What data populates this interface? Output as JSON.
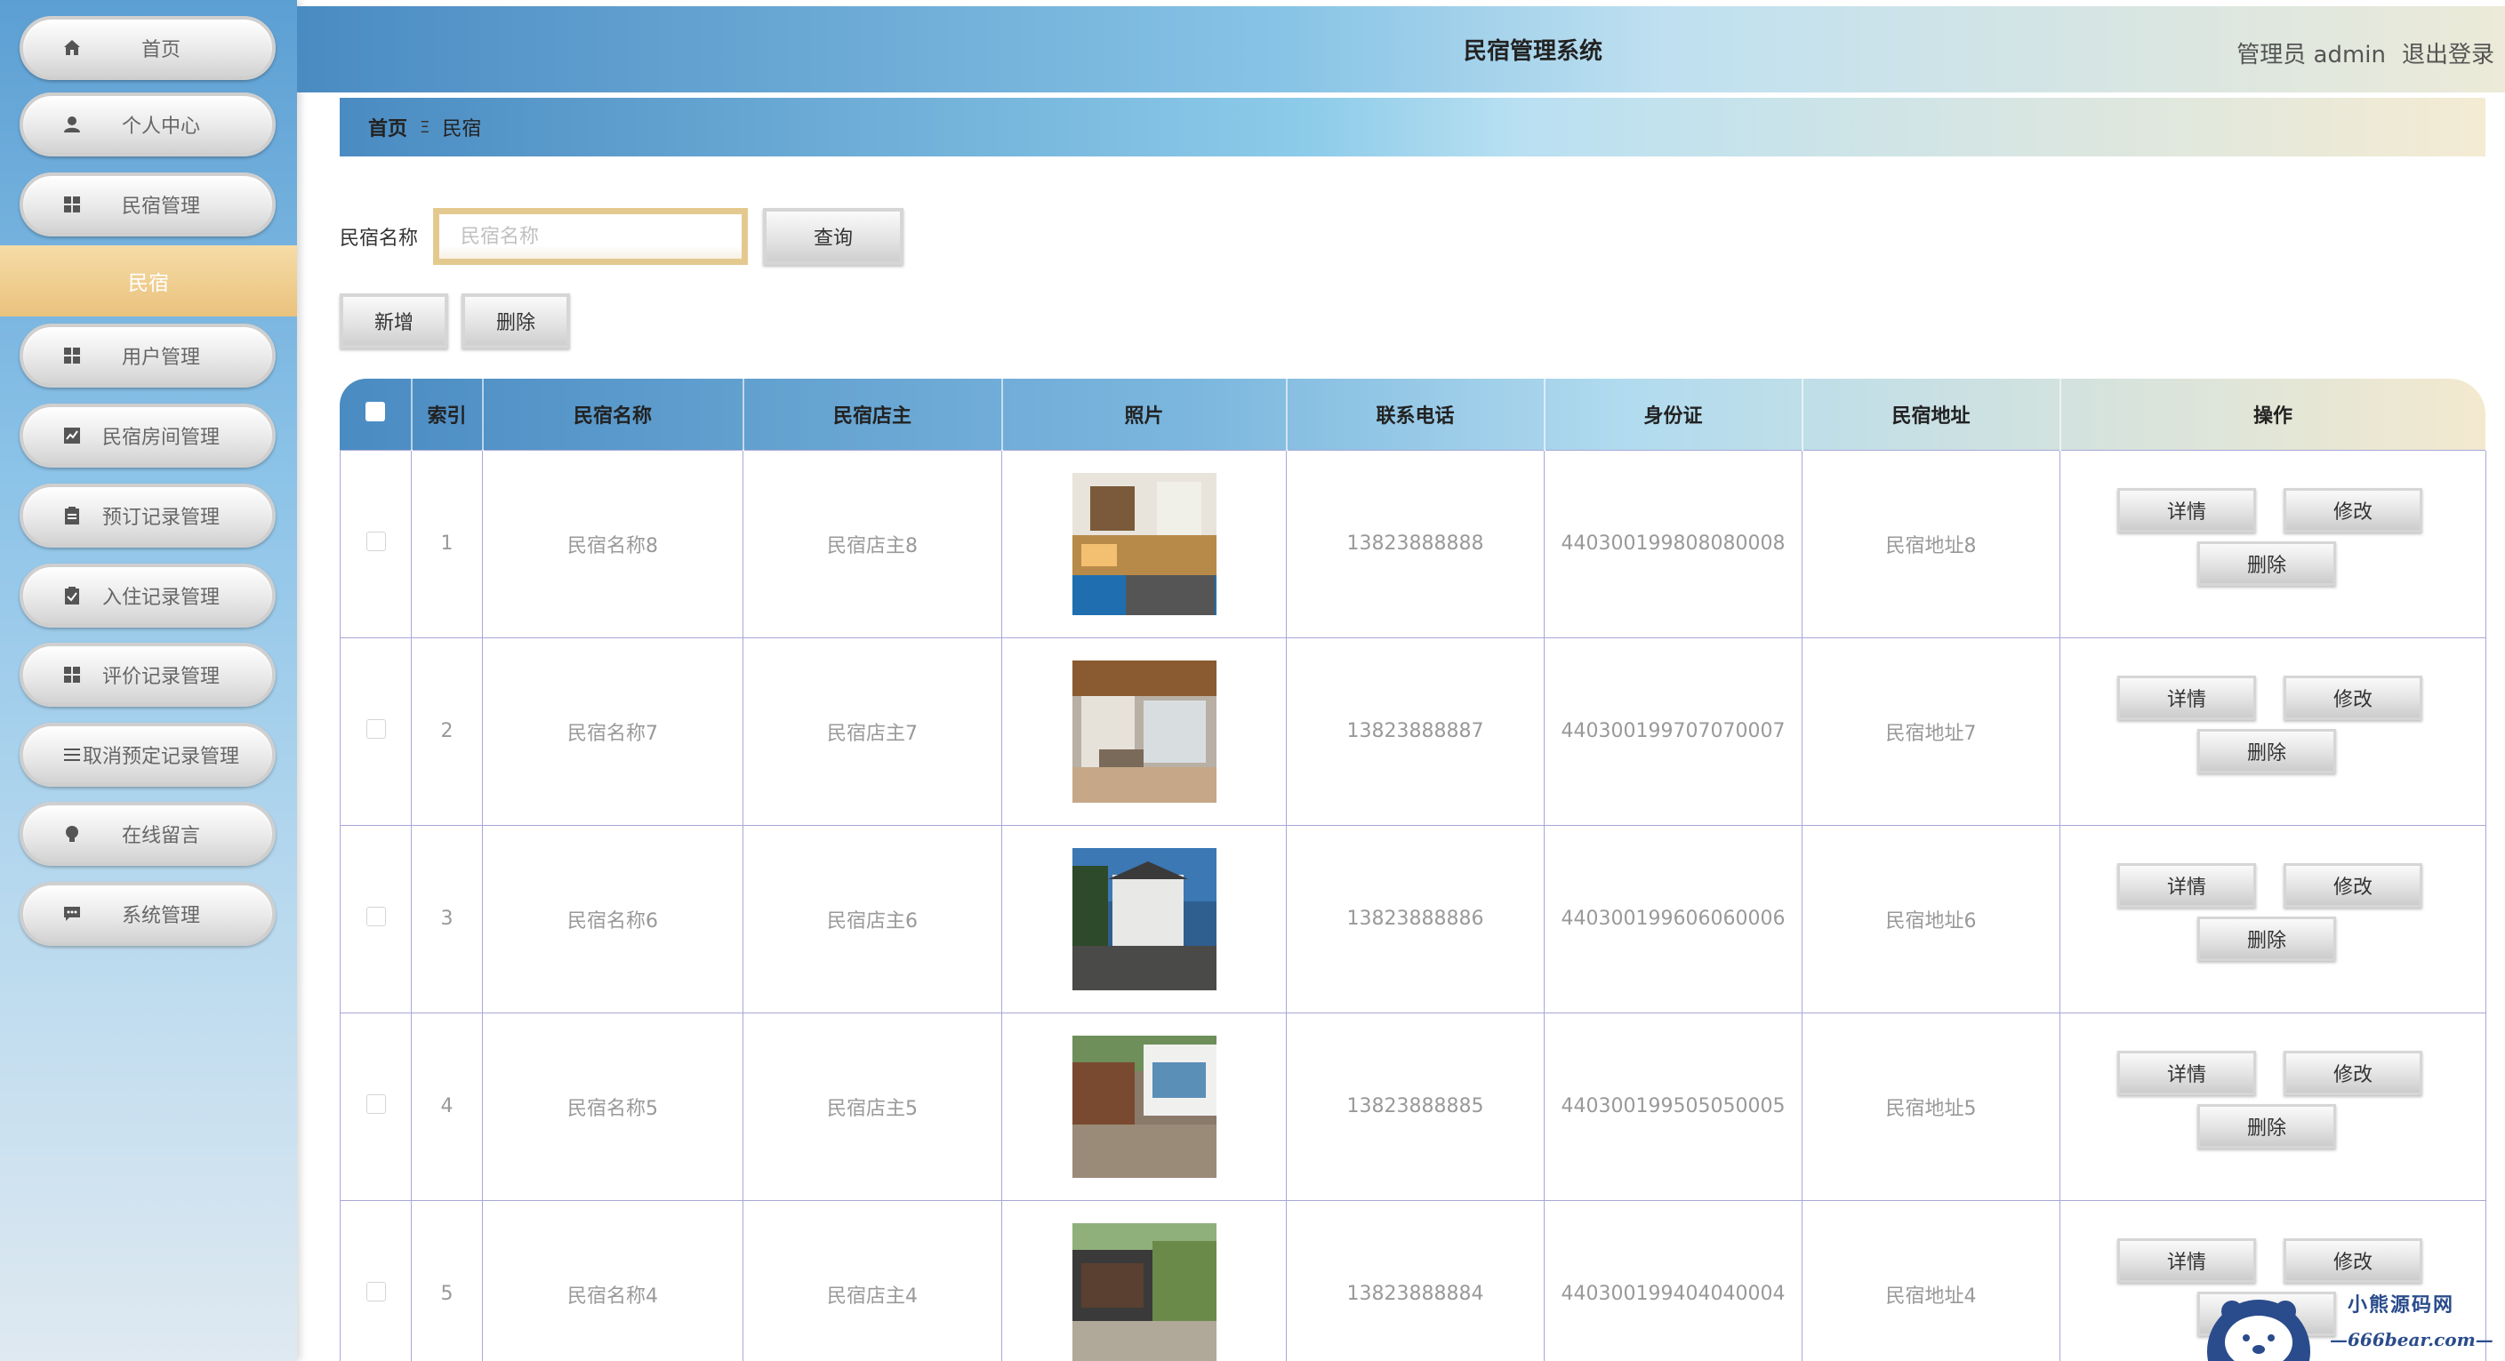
{
  "header": {
    "title": "民宿管理系统",
    "user_label": "管理员 admin",
    "logout_label": "退出登录"
  },
  "sidebar": {
    "items": [
      {
        "label": "首页",
        "icon": "home-icon"
      },
      {
        "label": "个人中心",
        "icon": "user-icon"
      },
      {
        "label": "民宿管理",
        "icon": "grid-icon"
      },
      {
        "label": "民宿",
        "active": true
      },
      {
        "label": "用户管理",
        "icon": "grid-icon"
      },
      {
        "label": "民宿房间管理",
        "icon": "chart-icon"
      },
      {
        "label": "预订记录管理",
        "icon": "clipboard-icon"
      },
      {
        "label": "入住记录管理",
        "icon": "clipboard-check-icon"
      },
      {
        "label": "评价记录管理",
        "icon": "grid-icon"
      },
      {
        "label": "取消预定记录管理",
        "icon": "list-icon"
      },
      {
        "label": "在线留言",
        "icon": "bulb-icon"
      },
      {
        "label": "系统管理",
        "icon": "chat-icon"
      }
    ]
  },
  "breadcrumb": {
    "home": "首页",
    "separator": "Ξ",
    "current": "民宿"
  },
  "search": {
    "label": "民宿名称",
    "placeholder": "民宿名称",
    "value": "",
    "query_label": "查询"
  },
  "toolbar": {
    "add_label": "新增",
    "delete_label": "删除"
  },
  "table": {
    "columns": [
      "索引",
      "民宿名称",
      "民宿店主",
      "照片",
      "联系电话",
      "身份证",
      "民宿地址",
      "操作"
    ],
    "rows": [
      {
        "index": "1",
        "name": "民宿名称8",
        "owner": "民宿店主8",
        "phone": "13823888888",
        "id_card": "440300199808080008",
        "address": "民宿地址8"
      },
      {
        "index": "2",
        "name": "民宿名称7",
        "owner": "民宿店主7",
        "phone": "13823888887",
        "id_card": "440300199707070007",
        "address": "民宿地址7"
      },
      {
        "index": "3",
        "name": "民宿名称6",
        "owner": "民宿店主6",
        "phone": "13823888886",
        "id_card": "440300199606060006",
        "address": "民宿地址6"
      },
      {
        "index": "4",
        "name": "民宿名称5",
        "owner": "民宿店主5",
        "phone": "13823888885",
        "id_card": "440300199505050005",
        "address": "民宿地址5"
      },
      {
        "index": "5",
        "name": "民宿名称4",
        "owner": "民宿店主4",
        "phone": "13823888884",
        "id_card": "440300199404040004",
        "address": "民宿地址4"
      }
    ],
    "ops": {
      "detail": "详情",
      "edit": "修改",
      "delete": "删除"
    }
  },
  "watermark": {
    "line1": "小熊源码网",
    "line2": "—666bear.com—"
  },
  "colors": {
    "accent_blue": "#4a8bc2",
    "accent_gold": "#e9c27d",
    "table_border": "#a8a7d8"
  }
}
